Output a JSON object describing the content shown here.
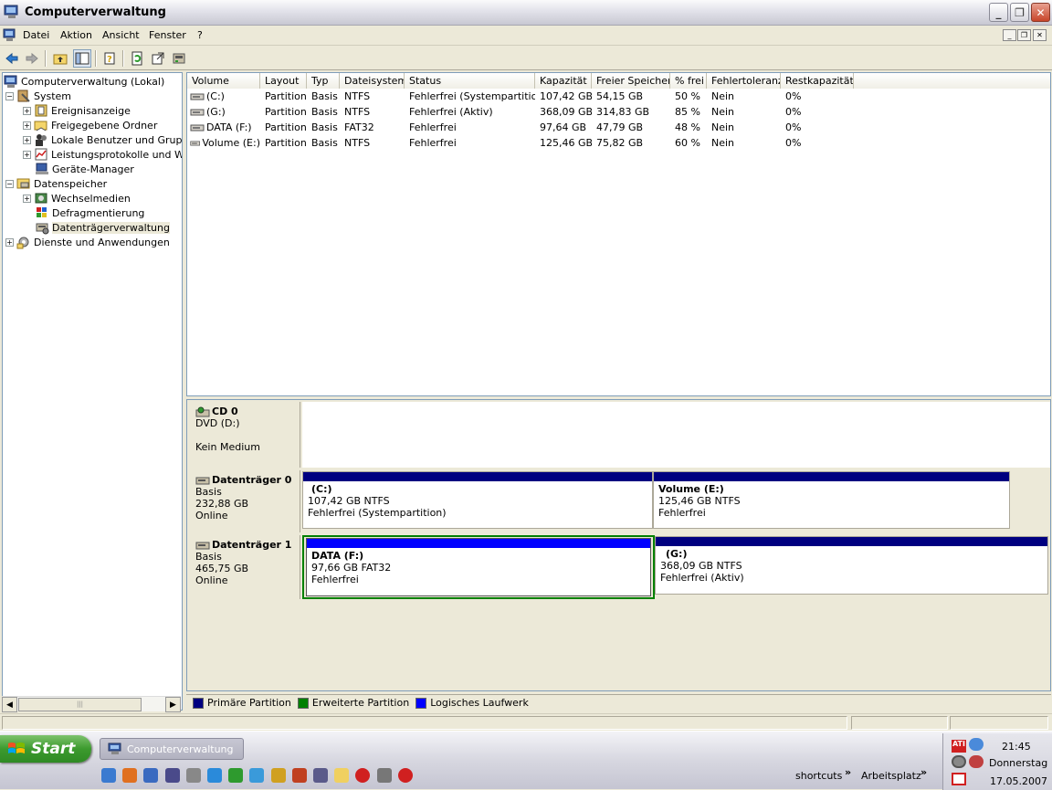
{
  "window": {
    "title": "Computerverwaltung",
    "controls": {
      "minimize": "_",
      "maximize": "❐",
      "close": "✕"
    }
  },
  "menubar": {
    "items": [
      "Datei",
      "Aktion",
      "Ansicht",
      "Fenster",
      "?"
    ]
  },
  "tree": {
    "root": "Computerverwaltung (Lokal)",
    "items": [
      {
        "label": "System",
        "expander": "−"
      },
      {
        "label": "Ereignisanzeige",
        "expander": "+"
      },
      {
        "label": "Freigegebene Ordner",
        "expander": "+"
      },
      {
        "label": "Lokale Benutzer und Gruppen",
        "expander": "+"
      },
      {
        "label": "Leistungsprotokolle und Warnungen",
        "expander": "+"
      },
      {
        "label": "Geräte-Manager",
        "expander": ""
      },
      {
        "label": "Datenspeicher",
        "expander": "−"
      },
      {
        "label": "Wechselmedien",
        "expander": "+"
      },
      {
        "label": "Defragmentierung",
        "expander": ""
      },
      {
        "label": "Datenträgerverwaltung",
        "expander": ""
      },
      {
        "label": "Dienste und Anwendungen",
        "expander": "+"
      }
    ]
  },
  "volume_list": {
    "columns": [
      "Volume",
      "Layout",
      "Typ",
      "Dateisystem",
      "Status",
      "Kapazität",
      "Freier Speicher",
      "% frei",
      "Fehlertoleranz",
      "Restkapazität"
    ],
    "rows": [
      [
        "(C:)",
        "Partition",
        "Basis",
        "NTFS",
        "Fehlerfrei (Systempartition)",
        "107,42 GB",
        "54,15 GB",
        "50 %",
        "Nein",
        "0%"
      ],
      [
        "(G:)",
        "Partition",
        "Basis",
        "NTFS",
        "Fehlerfrei (Aktiv)",
        "368,09 GB",
        "314,83 GB",
        "85 %",
        "Nein",
        "0%"
      ],
      [
        "DATA (F:)",
        "Partition",
        "Basis",
        "FAT32",
        "Fehlerfrei",
        "97,64 GB",
        "47,79 GB",
        "48 %",
        "Nein",
        "0%"
      ],
      [
        "Volume (E:)",
        "Partition",
        "Basis",
        "NTFS",
        "Fehlerfrei",
        "125,46 GB",
        "75,82 GB",
        "60 %",
        "Nein",
        "0%"
      ]
    ]
  },
  "disks": {
    "cd0": {
      "name": "CD 0",
      "type": "DVD (D:)",
      "status": "Kein Medium"
    },
    "disk0": {
      "name": "Datenträger 0",
      "type": "Basis",
      "size": "232,88 GB",
      "status": "Online",
      "partitions": [
        {
          "name": "(C:)",
          "size": "107,42 GB NTFS",
          "status": "Fehlerfrei (Systempartition)"
        },
        {
          "name": "Volume  (E:)",
          "size": "125,46 GB NTFS",
          "status": "Fehlerfrei"
        }
      ]
    },
    "disk1": {
      "name": "Datenträger 1",
      "type": "Basis",
      "size": "465,75 GB",
      "status": "Online",
      "partitions": [
        {
          "name": "DATA  (F:)",
          "size": "97,66 GB FAT32",
          "status": "Fehlerfrei"
        },
        {
          "name": "(G:)",
          "size": "368,09 GB NTFS",
          "status": "Fehlerfrei (Aktiv)"
        }
      ]
    }
  },
  "legend": {
    "items": [
      {
        "label": "Primäre Partition",
        "color": "#000080"
      },
      {
        "label": "Erweiterte Partition",
        "color": "#008000"
      },
      {
        "label": "Logisches Laufwerk",
        "color": "#0000FF"
      }
    ]
  },
  "taskbar": {
    "start": "Start",
    "task": "Computerverwaltung",
    "toolbars": [
      "shortcuts",
      "Arbeitsplatz"
    ],
    "chevron": "»",
    "clock": {
      "time": "21:45",
      "day": "Donnerstag",
      "date": "17.05.2007"
    }
  },
  "colors": {
    "primary_partition": "#000080",
    "logical_drive": "#0000FF",
    "extended_partition": "#008000",
    "window_bg": "#ECE9D8"
  }
}
